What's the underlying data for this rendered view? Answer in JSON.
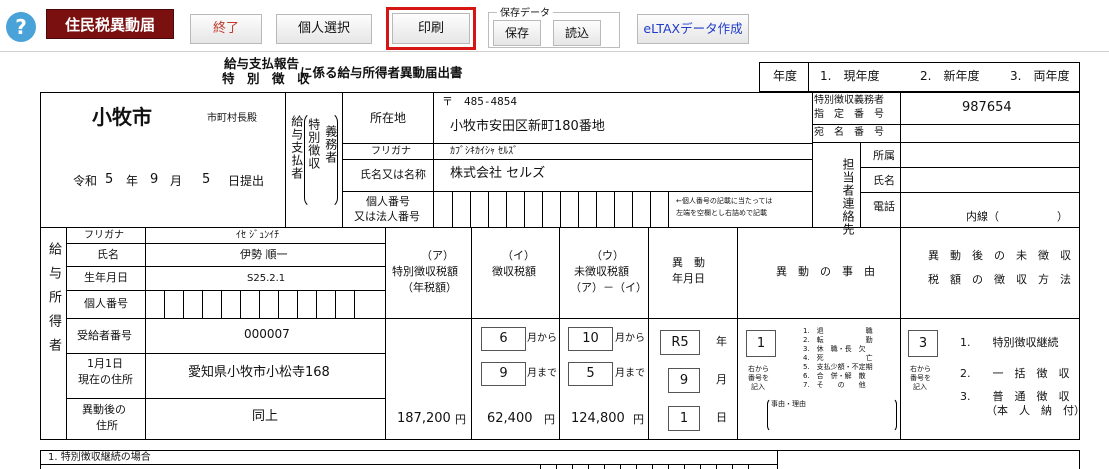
{
  "toolbar": {
    "help": "?",
    "app_title": "住民税異動届",
    "exit": "終了",
    "person_select": "個人選択",
    "print": "印刷",
    "save_group_label": "保存データ",
    "save": "保存",
    "load": "読込",
    "eltax": "eLTAXデータ作成"
  },
  "form": {
    "title_top_line1": "給与支払報告",
    "title_top_line2": "特　別　徴　収",
    "title_suffix": "に係る給与所得者異動届出書",
    "year_label": "年度",
    "year_opt1": "1.　現年度",
    "year_opt2": "2.　新年度",
    "year_opt3": "3.　両年度",
    "city": "小牧市",
    "mayor": "市町村長殿",
    "date_era": "令和",
    "date_year": "5",
    "date_year_unit": "年",
    "date_month": "9",
    "date_month_unit": "月",
    "date_day": "5",
    "date_day_unit": "日提出",
    "payer_vertical_1": "給与支払者",
    "payer_vertical_2": "特別徴収",
    "payer_vertical_3": "義務者",
    "address_label": "所在地",
    "postal": "〒　485-4854",
    "address": "小牧市安田区新町180番地",
    "kana_label": "フリガナ",
    "company_kana": "ｶﾌﾞｼｷｶｲｼｬ ｾﾙｽﾞ",
    "name_label": "氏名又は名称",
    "company_name": "株式会社 セルズ",
    "corp_no_label_1": "個人番号",
    "corp_no_label_2": "又は法人番号",
    "corp_no_note_1": "←個人番号の記載に当たっては",
    "corp_no_note_2": "左端を空欄とし右詰めで記載",
    "obligor_no_label_1": "特別徴収義務者",
    "obligor_no_label_2": "指　定　番　号",
    "obligor_no": "987654",
    "addressee_no_label": "宛　名　番　号",
    "contact_vertical": "担当者連絡先",
    "dept_label": "所属",
    "contact_name_label": "氏名",
    "phone_label": "電話",
    "ext_label": "内線（",
    "ext_close": "）",
    "person_vertical": "給与所得者",
    "p_kana_label": "フリガナ",
    "p_kana": "ｲｾ ｼﾞｭﾝｲﾁ",
    "p_name_label": "氏名",
    "p_name": "伊勢 順一",
    "p_birth_label": "生年月日",
    "p_birth": "S25.2.1",
    "p_my_no_label": "個人番号",
    "col_a_1": "（ア）",
    "col_a_2": "特別徴収税額",
    "col_a_3": "（年税額）",
    "col_i_1": "（イ）",
    "col_i_2": "徴収税額",
    "col_u_1": "（ウ）",
    "col_u_2": "未徴収税額",
    "col_u_3": "（ア）－（イ）",
    "col_date_1": "異　動",
    "col_date_2": "年月日",
    "col_reason": "異　動　の　事　由",
    "col_method_1": "異　動　後　の　未　徴　収",
    "col_method_2": "税　額　の　徴　収　方　法",
    "recipient_no_label": "受給者番号",
    "recipient_no": "000007",
    "jan1_label_1": "1月1日",
    "jan1_label_2": "現在の住所",
    "jan1_address": "愛知県小牧市小松寺168",
    "after_label_1": "異動後の",
    "after_label_2": "住所",
    "after_address": "同上",
    "tax_annual": "187,200",
    "yen": "円",
    "collect_from": "6",
    "collect_from_unit": "月から",
    "collect_to": "9",
    "collect_to_unit": "月まで",
    "collected": "62,400",
    "uncol_from": "10",
    "uncol_from_unit": "月から",
    "uncol_to": "5",
    "uncol_to_unit": "月まで",
    "uncollected": "124,800",
    "change_era_year": "R5",
    "change_year_unit": "年",
    "change_month": "9",
    "change_month_unit": "月",
    "change_day": "1",
    "change_day_unit": "日",
    "reason_code": "1",
    "reason_hint_1": "右から",
    "reason_hint_2": "番号を",
    "reason_hint_3": "記入",
    "reasons": [
      "1.　退　　　　　　職",
      "2.　転　　　　　　勤",
      "3.　休　職・長　欠",
      "4.　死　　　　　　亡",
      "5.　支払少額・不定期",
      "6.　合　併・解　散",
      "7.　そ　　の　　他"
    ],
    "reason_free_label": "事由・理由",
    "method_code": "3",
    "method_hint_1": "右から",
    "method_hint_2": "番号を",
    "method_hint_3": "記入",
    "method_1": "1.　　特別徴収継続",
    "method_2": "2.　　一　括　徴　収",
    "method_3a": "3.　　普　通　徴　収",
    "method_3b": "（本　人　納　付）",
    "bottom_section": "1. 特別徴収継続の場合"
  },
  "colors": {
    "title_bg": "#7b1010",
    "help": "#4aa3d8",
    "print_highlight": "#d61515",
    "eltax": "#1f3bc9",
    "exit": "#c0392b"
  }
}
